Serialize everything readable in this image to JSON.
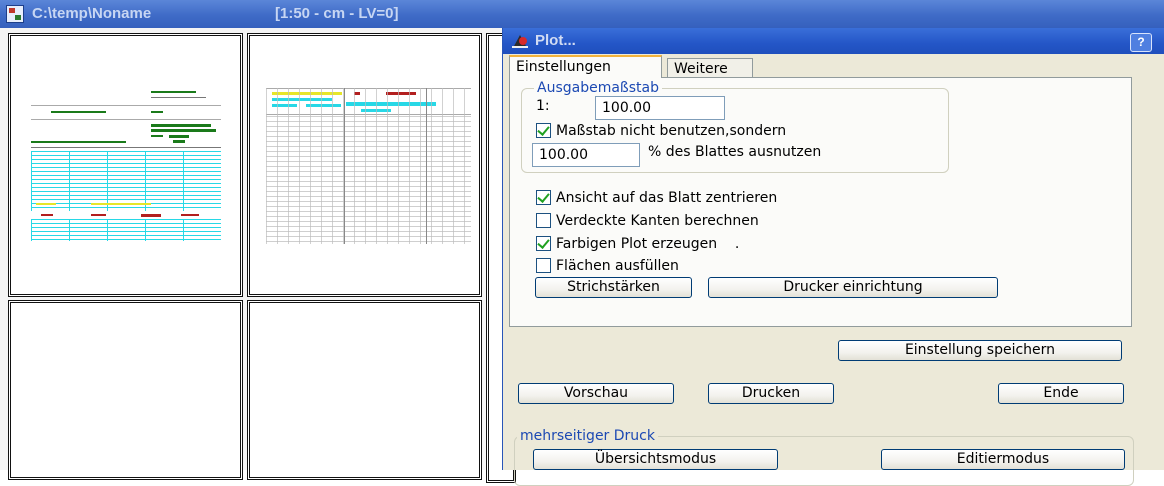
{
  "app": {
    "title": "C:\\temp\\Noname",
    "info": "[1:50 - cm - LV=0]"
  },
  "dialog": {
    "title": "Plot...",
    "help_label": "?",
    "tabs": [
      {
        "label": "Einstellungen",
        "active": true
      },
      {
        "label": "Weitere",
        "active": false
      }
    ],
    "scale_group": {
      "legend": "Ausgabemaßstab",
      "ratio_prefix": "1:",
      "ratio_value": "100.00",
      "ignore_scale_label": "Maßstab nicht benutzen,sondern",
      "ignore_scale_checked": true,
      "percent_value": "100.00",
      "percent_label": "% des Blattes ausnutzen"
    },
    "options": [
      {
        "label": "Ansicht auf das Blatt zentrieren",
        "checked": true
      },
      {
        "label": "Verdeckte Kanten berechnen",
        "checked": false
      },
      {
        "label": "Farbigen Plot erzeugen    .",
        "checked": true
      },
      {
        "label": "Flächen ausfüllen",
        "checked": false
      }
    ],
    "buttons": {
      "line_widths": "Strichstärken",
      "printer_setup": "Drucker einrichtung",
      "save_settings": "Einstellung speichern",
      "preview": "Vorschau",
      "print": "Drucken",
      "end": "Ende"
    },
    "multipage": {
      "legend": "mehrseitiger Druck",
      "overview_mode": "Übersichtsmodus",
      "edit_mode": "Editiermodus"
    }
  },
  "colors": {
    "titlebar": "#3f6bc7",
    "dialog_bg": "#ece9d8",
    "group_legend": "#1c49b3",
    "check_mark": "#21a121",
    "thumb_green": "#1a7a1a",
    "thumb_cyan": "#27d8e6",
    "thumb_red": "#b21f1f",
    "thumb_yellow": "#e6e62a"
  }
}
